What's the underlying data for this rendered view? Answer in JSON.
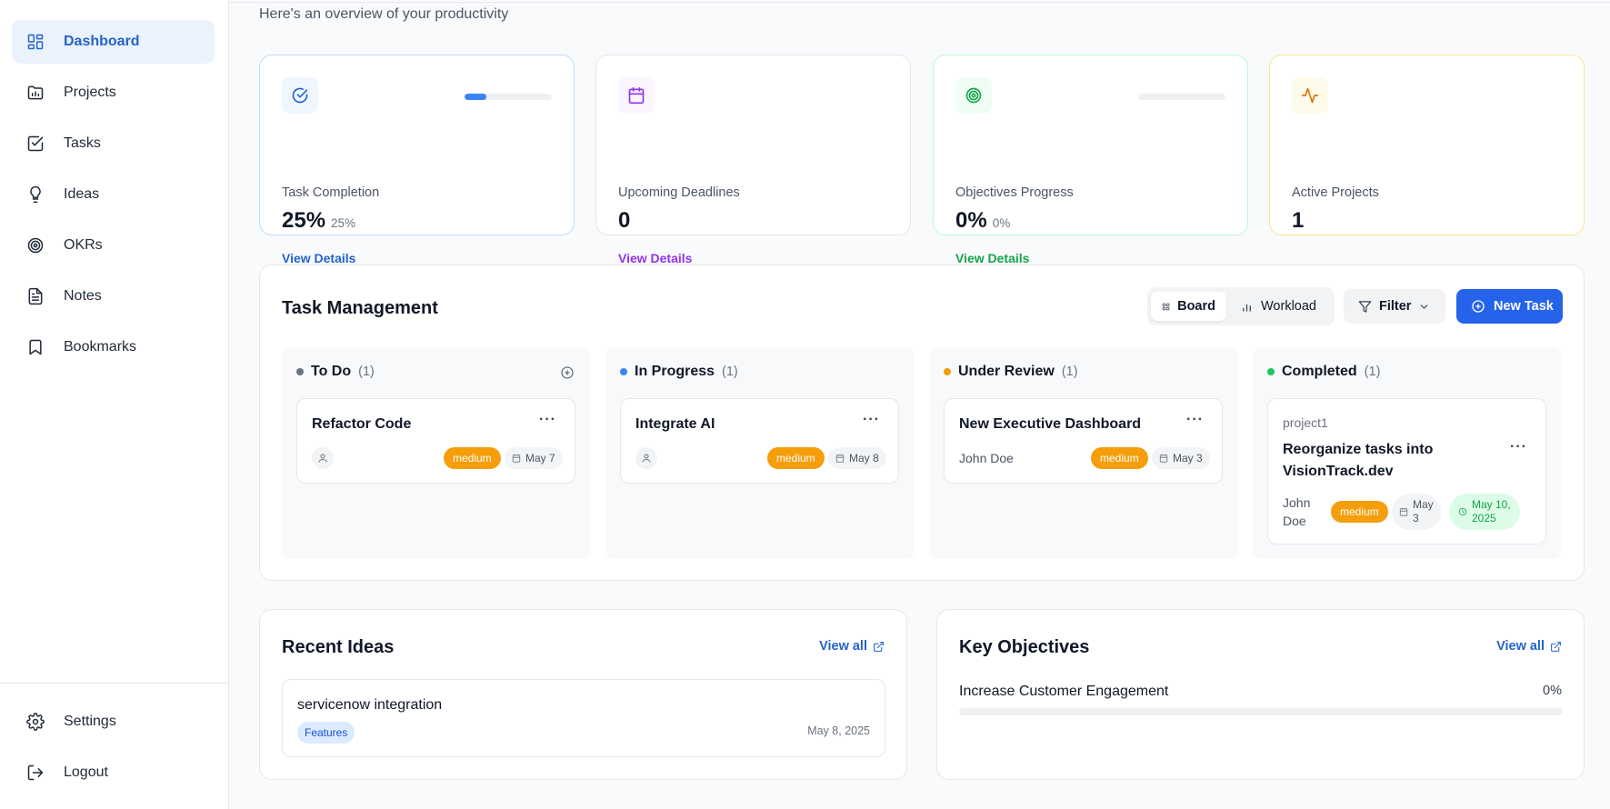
{
  "sidebar": {
    "items": [
      {
        "label": "Dashboard",
        "icon": "dashboard-icon",
        "active": true
      },
      {
        "label": "Projects",
        "icon": "projects-icon"
      },
      {
        "label": "Tasks",
        "icon": "tasks-icon"
      },
      {
        "label": "Ideas",
        "icon": "lightbulb-icon"
      },
      {
        "label": "OKRs",
        "icon": "target-icon"
      },
      {
        "label": "Notes",
        "icon": "notes-icon"
      },
      {
        "label": "Bookmarks",
        "icon": "bookmark-icon"
      }
    ],
    "bottom": [
      {
        "label": "Settings",
        "icon": "gear-icon"
      },
      {
        "label": "Logout",
        "icon": "logout-icon"
      }
    ]
  },
  "header": {
    "subtitle": "Here's an overview of your productivity"
  },
  "stats": [
    {
      "label": "Task Completion",
      "value": "25%",
      "sub": "25%",
      "link": "View Details",
      "progress": 0.25,
      "color": "#2563c9"
    },
    {
      "label": "Upcoming Deadlines",
      "value": "0",
      "link": "View Details",
      "color": "#9333ea"
    },
    {
      "label": "Objectives Progress",
      "value": "0%",
      "sub": "0%",
      "link": "View Details",
      "progress": 0,
      "color": "#16a34a"
    },
    {
      "label": "Active Projects",
      "value": "1",
      "color": "#d97706"
    }
  ],
  "task_management": {
    "title": "Task Management",
    "views": [
      "Board",
      "Workload"
    ],
    "filter_label": "Filter",
    "new_task_label": "New Task",
    "columns": [
      {
        "name": "To Do",
        "count": "(1)",
        "dot": "#6b7280",
        "card": {
          "title": "Refactor Code",
          "priority": "medium",
          "due": "May 7"
        }
      },
      {
        "name": "In Progress",
        "count": "(1)",
        "dot": "#3b82f6",
        "card": {
          "title": "Integrate AI",
          "priority": "medium",
          "due": "May 8"
        }
      },
      {
        "name": "Under Review",
        "count": "(1)",
        "dot": "#f59e0b",
        "card": {
          "title": "New Executive Dashboard",
          "assignee": "John Doe",
          "priority": "medium",
          "due": "May 3"
        }
      },
      {
        "name": "Completed",
        "count": "(1)",
        "dot": "#22c55e",
        "card": {
          "project": "project1",
          "title_line1": "Reorganize tasks into",
          "title_line2": "VisionTrack.dev",
          "assignee_line1": "John",
          "assignee_line2": "Doe",
          "priority": "medium",
          "due_line1": "May",
          "due_line2": "3",
          "completed_line1": "May 10,",
          "completed_line2": "2025"
        }
      }
    ]
  },
  "recent_ideas": {
    "title": "Recent Ideas",
    "view_all": "View all",
    "items": [
      {
        "title": "servicenow integration",
        "tag": "Features",
        "date": "May 8, 2025"
      }
    ]
  },
  "key_objectives": {
    "title": "Key Objectives",
    "view_all": "View all",
    "items": [
      {
        "name": "Increase Customer Engagement",
        "percent": "0%",
        "progress": 0
      }
    ]
  }
}
